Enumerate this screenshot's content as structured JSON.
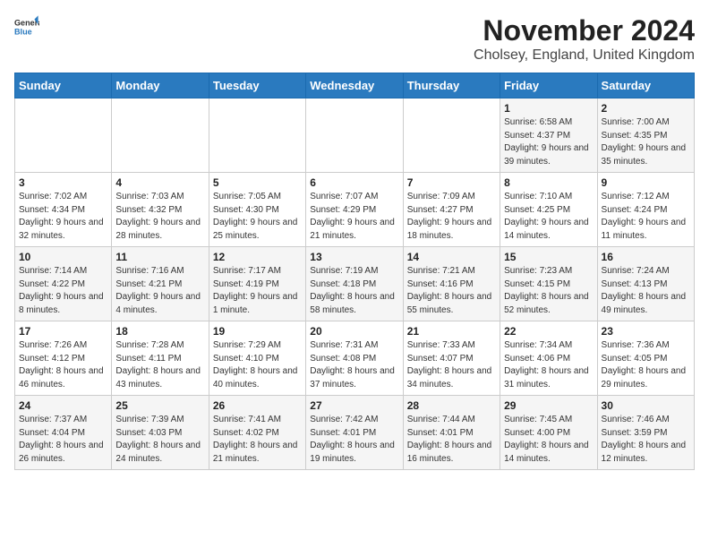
{
  "logo": {
    "general": "General",
    "blue": "Blue"
  },
  "title": "November 2024",
  "subtitle": "Cholsey, England, United Kingdom",
  "days_of_week": [
    "Sunday",
    "Monday",
    "Tuesday",
    "Wednesday",
    "Thursday",
    "Friday",
    "Saturday"
  ],
  "weeks": [
    [
      {
        "day": "",
        "info": ""
      },
      {
        "day": "",
        "info": ""
      },
      {
        "day": "",
        "info": ""
      },
      {
        "day": "",
        "info": ""
      },
      {
        "day": "",
        "info": ""
      },
      {
        "day": "1",
        "info": "Sunrise: 6:58 AM\nSunset: 4:37 PM\nDaylight: 9 hours and 39 minutes."
      },
      {
        "day": "2",
        "info": "Sunrise: 7:00 AM\nSunset: 4:35 PM\nDaylight: 9 hours and 35 minutes."
      }
    ],
    [
      {
        "day": "3",
        "info": "Sunrise: 7:02 AM\nSunset: 4:34 PM\nDaylight: 9 hours and 32 minutes."
      },
      {
        "day": "4",
        "info": "Sunrise: 7:03 AM\nSunset: 4:32 PM\nDaylight: 9 hours and 28 minutes."
      },
      {
        "day": "5",
        "info": "Sunrise: 7:05 AM\nSunset: 4:30 PM\nDaylight: 9 hours and 25 minutes."
      },
      {
        "day": "6",
        "info": "Sunrise: 7:07 AM\nSunset: 4:29 PM\nDaylight: 9 hours and 21 minutes."
      },
      {
        "day": "7",
        "info": "Sunrise: 7:09 AM\nSunset: 4:27 PM\nDaylight: 9 hours and 18 minutes."
      },
      {
        "day": "8",
        "info": "Sunrise: 7:10 AM\nSunset: 4:25 PM\nDaylight: 9 hours and 14 minutes."
      },
      {
        "day": "9",
        "info": "Sunrise: 7:12 AM\nSunset: 4:24 PM\nDaylight: 9 hours and 11 minutes."
      }
    ],
    [
      {
        "day": "10",
        "info": "Sunrise: 7:14 AM\nSunset: 4:22 PM\nDaylight: 9 hours and 8 minutes."
      },
      {
        "day": "11",
        "info": "Sunrise: 7:16 AM\nSunset: 4:21 PM\nDaylight: 9 hours and 4 minutes."
      },
      {
        "day": "12",
        "info": "Sunrise: 7:17 AM\nSunset: 4:19 PM\nDaylight: 9 hours and 1 minute."
      },
      {
        "day": "13",
        "info": "Sunrise: 7:19 AM\nSunset: 4:18 PM\nDaylight: 8 hours and 58 minutes."
      },
      {
        "day": "14",
        "info": "Sunrise: 7:21 AM\nSunset: 4:16 PM\nDaylight: 8 hours and 55 minutes."
      },
      {
        "day": "15",
        "info": "Sunrise: 7:23 AM\nSunset: 4:15 PM\nDaylight: 8 hours and 52 minutes."
      },
      {
        "day": "16",
        "info": "Sunrise: 7:24 AM\nSunset: 4:13 PM\nDaylight: 8 hours and 49 minutes."
      }
    ],
    [
      {
        "day": "17",
        "info": "Sunrise: 7:26 AM\nSunset: 4:12 PM\nDaylight: 8 hours and 46 minutes."
      },
      {
        "day": "18",
        "info": "Sunrise: 7:28 AM\nSunset: 4:11 PM\nDaylight: 8 hours and 43 minutes."
      },
      {
        "day": "19",
        "info": "Sunrise: 7:29 AM\nSunset: 4:10 PM\nDaylight: 8 hours and 40 minutes."
      },
      {
        "day": "20",
        "info": "Sunrise: 7:31 AM\nSunset: 4:08 PM\nDaylight: 8 hours and 37 minutes."
      },
      {
        "day": "21",
        "info": "Sunrise: 7:33 AM\nSunset: 4:07 PM\nDaylight: 8 hours and 34 minutes."
      },
      {
        "day": "22",
        "info": "Sunrise: 7:34 AM\nSunset: 4:06 PM\nDaylight: 8 hours and 31 minutes."
      },
      {
        "day": "23",
        "info": "Sunrise: 7:36 AM\nSunset: 4:05 PM\nDaylight: 8 hours and 29 minutes."
      }
    ],
    [
      {
        "day": "24",
        "info": "Sunrise: 7:37 AM\nSunset: 4:04 PM\nDaylight: 8 hours and 26 minutes."
      },
      {
        "day": "25",
        "info": "Sunrise: 7:39 AM\nSunset: 4:03 PM\nDaylight: 8 hours and 24 minutes."
      },
      {
        "day": "26",
        "info": "Sunrise: 7:41 AM\nSunset: 4:02 PM\nDaylight: 8 hours and 21 minutes."
      },
      {
        "day": "27",
        "info": "Sunrise: 7:42 AM\nSunset: 4:01 PM\nDaylight: 8 hours and 19 minutes."
      },
      {
        "day": "28",
        "info": "Sunrise: 7:44 AM\nSunset: 4:01 PM\nDaylight: 8 hours and 16 minutes."
      },
      {
        "day": "29",
        "info": "Sunrise: 7:45 AM\nSunset: 4:00 PM\nDaylight: 8 hours and 14 minutes."
      },
      {
        "day": "30",
        "info": "Sunrise: 7:46 AM\nSunset: 3:59 PM\nDaylight: 8 hours and 12 minutes."
      }
    ]
  ]
}
